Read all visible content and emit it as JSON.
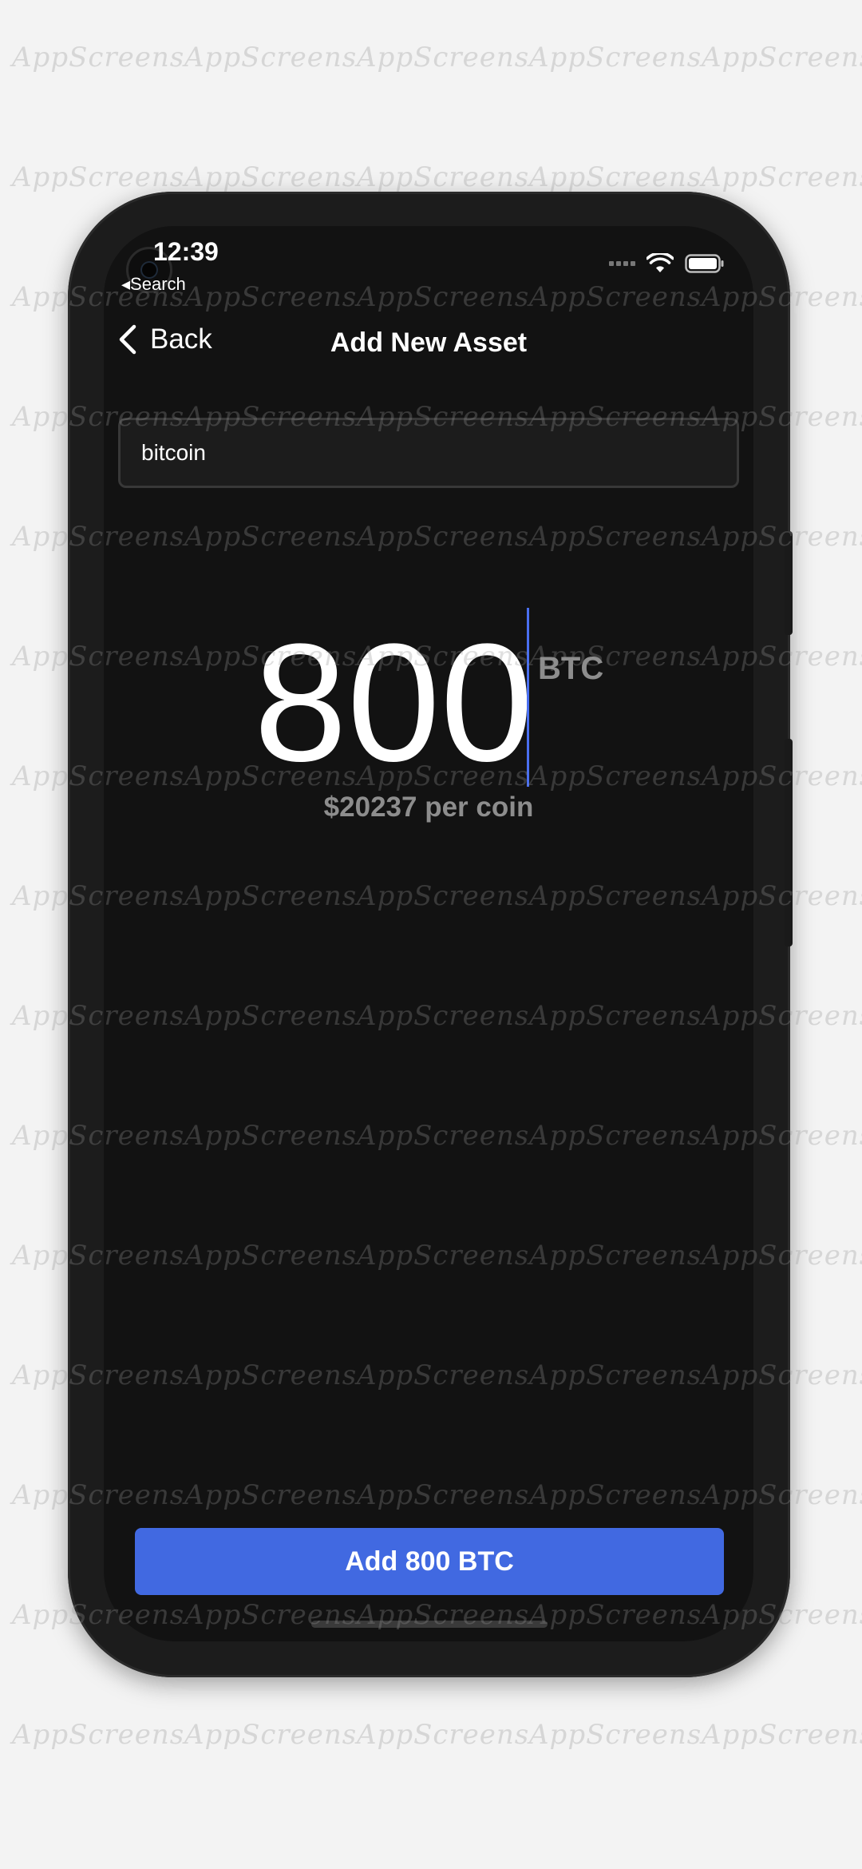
{
  "status_bar": {
    "time": "12:39",
    "back_app": "Search"
  },
  "nav": {
    "back_label": "Back",
    "title": "Add New Asset"
  },
  "search": {
    "value": "bitcoin"
  },
  "amount": {
    "value": "800",
    "unit": "BTC",
    "price_text": "$20237 per coin"
  },
  "actions": {
    "add_label": "Add 800 BTC"
  },
  "watermark": {
    "text": "AppScreens"
  },
  "colors": {
    "accent": "#4169e1",
    "caret": "#4a6ff0",
    "background": "#121212",
    "muted_text": "#8d8d8d"
  },
  "icons": [
    "back-chevron-icon",
    "wifi-icon",
    "battery-icon",
    "cellular-signal-icon",
    "camera-icon"
  ]
}
